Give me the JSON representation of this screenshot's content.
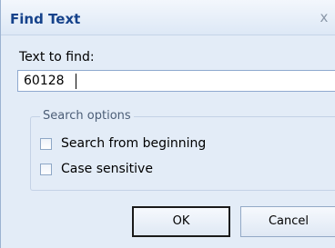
{
  "dialog": {
    "title": "Find Text",
    "close_glyph": "x",
    "text_label": "Text to find:",
    "text_value": "60128",
    "options_legend": "Search options",
    "options": [
      {
        "label": "Search from beginning",
        "checked": false
      },
      {
        "label": "Case sensitive",
        "checked": false
      }
    ],
    "ok_label": "OK",
    "cancel_label": "Cancel"
  },
  "colors": {
    "title_text": "#15428b",
    "dialog_bg": "#e3ecf7",
    "border": "#9cb3d1"
  },
  "icons": {
    "close": "close-icon"
  }
}
